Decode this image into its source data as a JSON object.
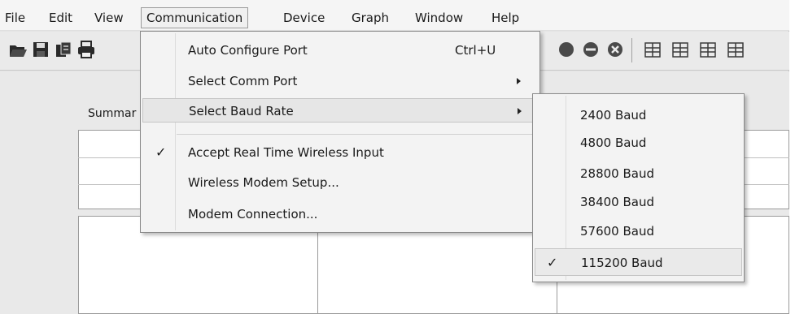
{
  "menubar": {
    "items": [
      "File",
      "Edit",
      "View",
      "Communication",
      "Device",
      "Graph",
      "Window",
      "Help"
    ]
  },
  "toolbar": {
    "icons": [
      "open-folder-icon",
      "save-icon",
      "copy-icon",
      "print-icon",
      "record-icon",
      "stop-icon",
      "cancel-icon",
      "grid-a-icon",
      "grid-b-icon",
      "grid-c-icon",
      "grid-d-icon"
    ]
  },
  "tabs": {
    "summary_label": "Summar"
  },
  "communication_menu": {
    "items": [
      {
        "label": "Auto Configure Port",
        "shortcut": "Ctrl+U"
      },
      {
        "label": "Select Comm Port",
        "submenu": true
      },
      {
        "label": "Select Baud Rate",
        "submenu": true
      },
      {
        "label": "Accept Real Time Wireless Input",
        "checked": true
      },
      {
        "label": "Wireless Modem Setup..."
      },
      {
        "label": "Modem Connection..."
      }
    ]
  },
  "baud_submenu": {
    "items": [
      {
        "label": "2400 Baud"
      },
      {
        "label": "4800 Baud"
      },
      {
        "label": "28800 Baud"
      },
      {
        "label": "38400 Baud"
      },
      {
        "label": "57600 Baud"
      },
      {
        "label": "115200 Baud",
        "checked": true
      }
    ],
    "check_glyph": "✓"
  },
  "check_glyph": "✓"
}
